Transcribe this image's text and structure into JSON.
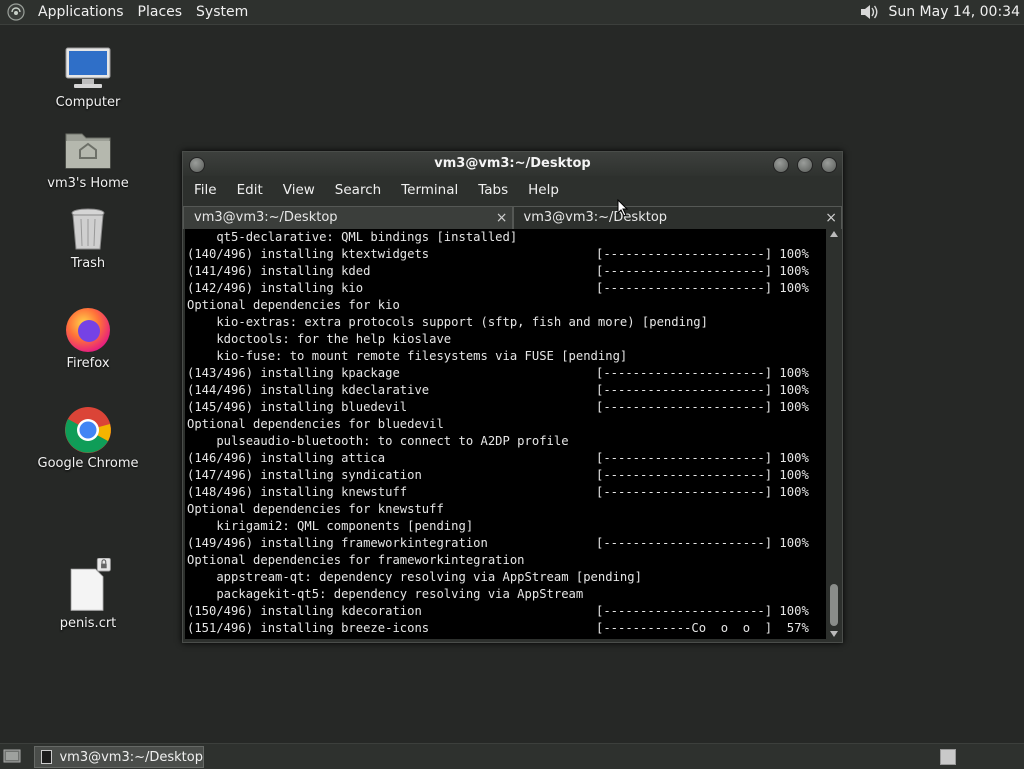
{
  "top_panel": {
    "menus": [
      "Applications",
      "Places",
      "System"
    ],
    "clock": "Sun May 14, 00:34"
  },
  "desktop_icons": [
    {
      "label": "Computer"
    },
    {
      "label": "vm3's Home"
    },
    {
      "label": "Trash"
    },
    {
      "label": "Firefox"
    },
    {
      "label": "Google Chrome"
    },
    {
      "label": "penis.crt"
    }
  ],
  "terminal": {
    "title": "vm3@vm3:~/Desktop",
    "menus": [
      "File",
      "Edit",
      "View",
      "Search",
      "Terminal",
      "Tabs",
      "Help"
    ],
    "tabs": [
      {
        "label": "vm3@vm3:~/Desktop",
        "close": "×"
      },
      {
        "label": "vm3@vm3:~/Desktop",
        "close": "×"
      }
    ],
    "lines": [
      {
        "text": "    qt5-declarative: QML bindings [installed]",
        "progress": ""
      },
      {
        "text": "(140/496) installing ktextwidgets",
        "progress": "[----------------------] 100%"
      },
      {
        "text": "(141/496) installing kded",
        "progress": "[----------------------] 100%"
      },
      {
        "text": "(142/496) installing kio",
        "progress": "[----------------------] 100%"
      },
      {
        "text": "Optional dependencies for kio",
        "progress": ""
      },
      {
        "text": "    kio-extras: extra protocols support (sftp, fish and more) [pending]",
        "progress": ""
      },
      {
        "text": "    kdoctools: for the help kioslave",
        "progress": ""
      },
      {
        "text": "    kio-fuse: to mount remote filesystems via FUSE [pending]",
        "progress": ""
      },
      {
        "text": "(143/496) installing kpackage",
        "progress": "[----------------------] 100%"
      },
      {
        "text": "(144/496) installing kdeclarative",
        "progress": "[----------------------] 100%"
      },
      {
        "text": "(145/496) installing bluedevil",
        "progress": "[----------------------] 100%"
      },
      {
        "text": "Optional dependencies for bluedevil",
        "progress": ""
      },
      {
        "text": "    pulseaudio-bluetooth: to connect to A2DP profile",
        "progress": ""
      },
      {
        "text": "(146/496) installing attica",
        "progress": "[----------------------] 100%"
      },
      {
        "text": "(147/496) installing syndication",
        "progress": "[----------------------] 100%"
      },
      {
        "text": "(148/496) installing knewstuff",
        "progress": "[----------------------] 100%"
      },
      {
        "text": "Optional dependencies for knewstuff",
        "progress": ""
      },
      {
        "text": "    kirigami2: QML components [pending]",
        "progress": ""
      },
      {
        "text": "(149/496) installing frameworkintegration",
        "progress": "[----------------------] 100%"
      },
      {
        "text": "Optional dependencies for frameworkintegration",
        "progress": ""
      },
      {
        "text": "    appstream-qt: dependency resolving via AppStream [pending]",
        "progress": ""
      },
      {
        "text": "    packagekit-qt5: dependency resolving via AppStream",
        "progress": ""
      },
      {
        "text": "(150/496) installing kdecoration",
        "progress": "[----------------------] 100%"
      },
      {
        "text": "(151/496) installing breeze-icons",
        "progress": "[------------Co  o  o  ]  57%"
      }
    ]
  },
  "taskbar": {
    "window_button": "vm3@vm3:~/Desktop"
  }
}
